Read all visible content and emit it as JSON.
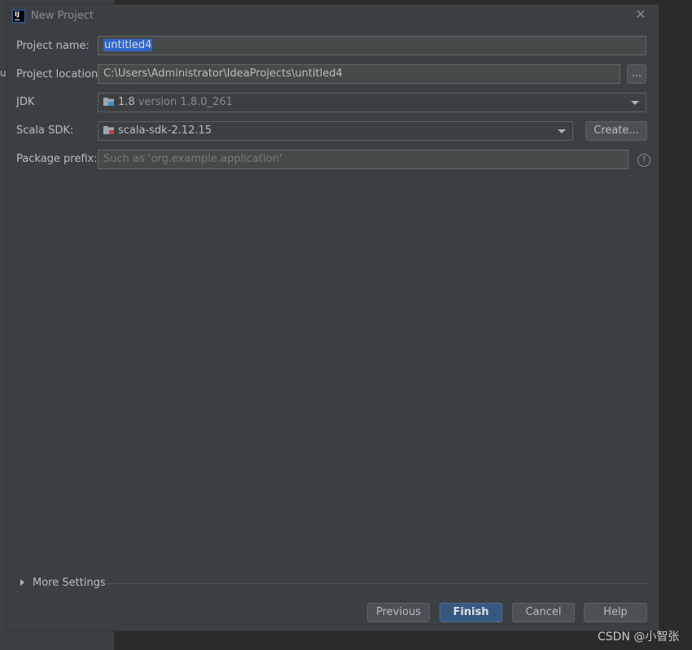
{
  "background": {
    "left_fragment": "us"
  },
  "watermark": "CSDN @小智张",
  "dialog": {
    "title": "New Project",
    "fields": {
      "project_name": {
        "label": "Project name:",
        "value": "untitled4"
      },
      "project_location": {
        "label": "Project location:",
        "value": "C:\\Users\\Administrator\\IdeaProjects\\untitled4",
        "browse_label": "..."
      },
      "jdk": {
        "label": "JDK",
        "value": "1.8",
        "detail": "version 1.8.0_261"
      },
      "scala_sdk": {
        "label": "Scala SDK:",
        "value": "scala-sdk-2.12.15",
        "create_label": "Create..."
      },
      "package_prefix": {
        "label": "Package prefix:",
        "placeholder": "Such as 'org.example.application'",
        "help_label": "?"
      }
    },
    "more_settings": "More Settings",
    "buttons": {
      "previous": "Previous",
      "finish": "Finish",
      "cancel": "Cancel",
      "help": "Help"
    }
  },
  "icons": {
    "app": "intellij-idea-icon",
    "close": "close-icon",
    "jdk": "folder-icon",
    "sdk": "scala-library-icon"
  },
  "colors": {
    "accent": "#365880",
    "selection": "#2f65ca",
    "dialog_bg": "#3c3f41"
  }
}
